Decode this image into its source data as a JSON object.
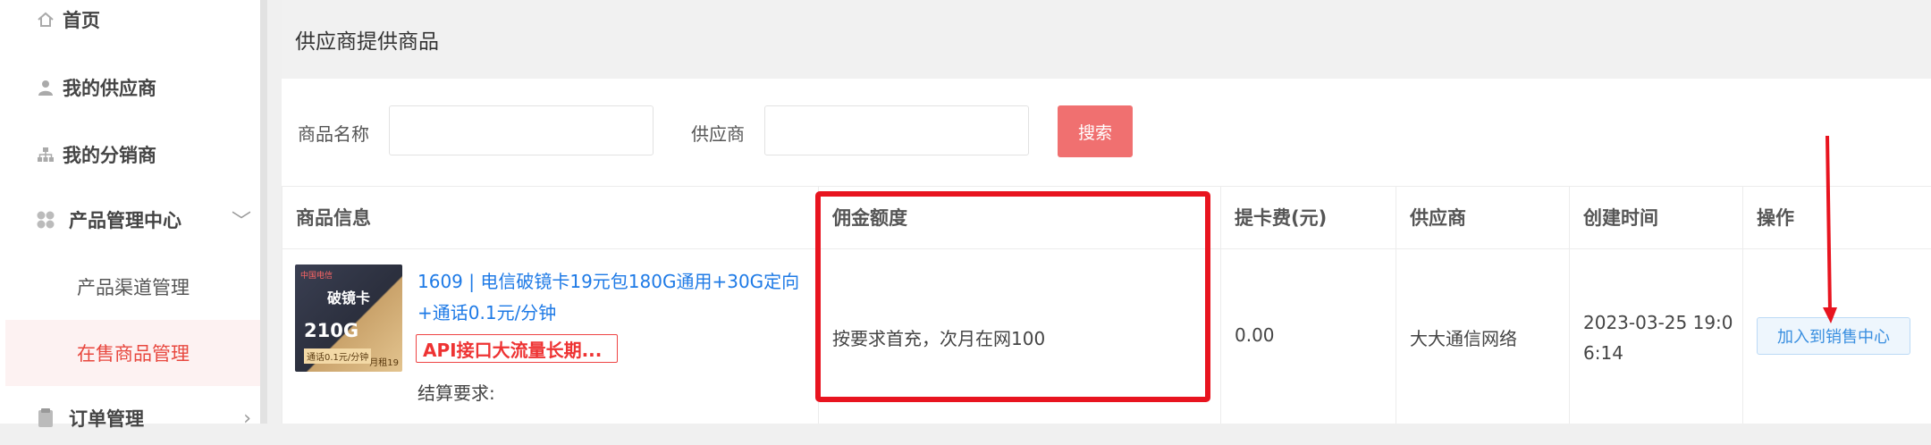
{
  "sidebar": {
    "items": [
      {
        "label": "首页",
        "icon": "home-icon"
      },
      {
        "label": "我的供应商",
        "icon": "user-icon"
      },
      {
        "label": "我的分销商",
        "icon": "org-icon"
      },
      {
        "label": "产品管理中心",
        "icon": "apps-icon",
        "chevron": "﹀"
      },
      {
        "label": "订单管理",
        "icon": "doc-icon",
        "chevron": "›"
      }
    ],
    "sub_items": [
      {
        "label": "产品渠道管理"
      },
      {
        "label": "在售商品管理",
        "active": true
      }
    ]
  },
  "panel": {
    "title": "供应商提供商品"
  },
  "search": {
    "name_label": "商品名称",
    "name_value": "",
    "supplier_label": "供应商",
    "supplier_value": "",
    "button_label": "搜索"
  },
  "table": {
    "headers": [
      "商品信息",
      "佣金额度",
      "提卡费(元)",
      "供应商",
      "创建时间",
      "操作"
    ],
    "rows": [
      {
        "thumb": {
          "brand": "中国电信",
          "name": "破镜卡",
          "data": "210G",
          "note": "通话0.1元/分钟",
          "rent": "月租19"
        },
        "product_link": "1609 | 电信破镜卡19元包180G通用+30G定向+通话0.1元/分钟",
        "tag": "API接口大流量长期...",
        "requirement": "结算要求:",
        "commission": "按要求首充，次月在网100",
        "fee": "0.00",
        "supplier": "大大通信网络",
        "created": "2023-03-25 19:06:14",
        "created_line1": "2023-03-25 19:0",
        "created_line2": "6:14",
        "action": "加入到销售中心"
      }
    ]
  },
  "colors": {
    "accent_red": "#e8141f",
    "search_button": "#f07070",
    "link_blue": "#1e7ae6",
    "active_menu_text": "#e8483f"
  }
}
